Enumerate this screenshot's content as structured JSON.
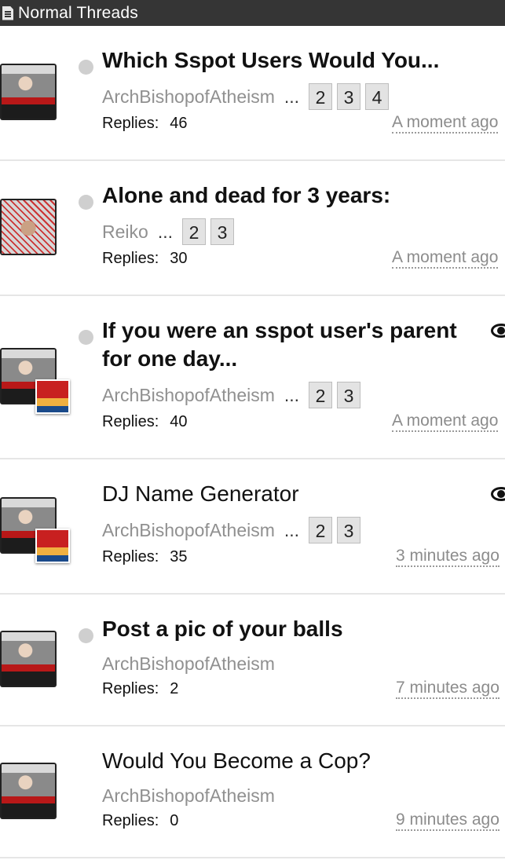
{
  "header": {
    "title": "Normal Threads"
  },
  "threads": [
    {
      "title": "Which Sspot Users Would You...",
      "bold": true,
      "author": "ArchBishopofAtheism",
      "pages": [
        "2",
        "3",
        "4"
      ],
      "replies_label": "Replies:",
      "replies": "46",
      "time": "A moment ago"
    },
    {
      "title": "Alone and dead for 3 years:",
      "bold": true,
      "author": "Reiko",
      "pages": [
        "2",
        "3"
      ],
      "replies_label": "Replies:",
      "replies": "30",
      "time": "A moment ago"
    },
    {
      "title_line1": "If you were an sspot user's parent",
      "title_line2": "for one day...",
      "bold": true,
      "author": "ArchBishopofAtheism",
      "pages": [
        "2",
        "3"
      ],
      "replies_label": "Replies:",
      "replies": "40",
      "time": "A moment ago",
      "watched": true
    },
    {
      "title": "DJ Name Generator",
      "bold": false,
      "author": "ArchBishopofAtheism",
      "pages": [
        "2",
        "3"
      ],
      "replies_label": "Replies:",
      "replies": "35",
      "time": "3 minutes ago",
      "watched": true
    },
    {
      "title": "Post a pic of your balls",
      "bold": true,
      "author": "ArchBishopofAtheism",
      "pages": [],
      "replies_label": "Replies:",
      "replies": "2",
      "time": "7 minutes ago"
    },
    {
      "title": "Would You Become a Cop?",
      "bold": false,
      "author": "ArchBishopofAtheism",
      "pages": [],
      "replies_label": "Replies:",
      "replies": "0",
      "time": "9 minutes ago"
    }
  ],
  "ellipsis": "...",
  "icons": {
    "header": "document-icon",
    "unread": "unread-dot-icon",
    "watch": "eye-icon"
  },
  "colors": {
    "header_bg": "#353535",
    "meta_text": "#909090",
    "time_text": "#8c8c8c"
  }
}
